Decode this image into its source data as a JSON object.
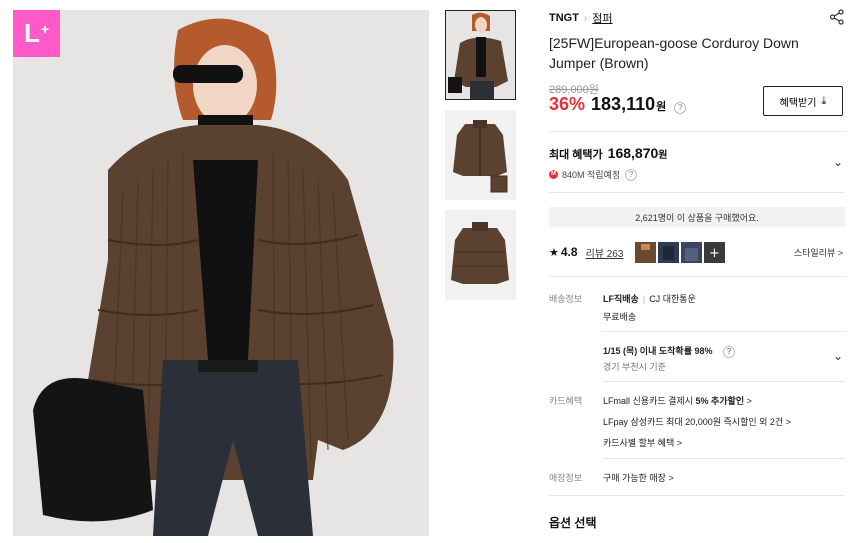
{
  "badge": {
    "text": "L",
    "plus": "+"
  },
  "product": {
    "brand": "TNGT",
    "category": "점퍼",
    "title": "[25FW]European-goose Corduroy Down Jumper (Brown)",
    "original_price": "289,000원",
    "discount": "36%",
    "price": "183,110",
    "currency": "원",
    "benefit_button": "혜택받기"
  },
  "max_benefit": {
    "label": "최대 혜택가",
    "price": "168,870",
    "currency": "원",
    "points": "840M 적립예정"
  },
  "purchase_notice": "2,621명이 이 상품을 구매했어요.",
  "reviews": {
    "rating": "4.8",
    "label": "리뷰 263",
    "style_link": "스타일리뷰 >"
  },
  "shipping": {
    "label": "배송정보",
    "method": "LF직배송",
    "carrier": "CJ 대한통운",
    "fee": "무료배송",
    "arrival": "1/15 (목) 이내 도착확률 98%",
    "origin": "경기 부천시 기준"
  },
  "card": {
    "label": "카드혜택",
    "line1_prefix": "LFmall 신용카드 결제시 ",
    "line1_bold": "5% 추가할인",
    "line1_suffix": " >",
    "line2": "LFpay 삼성카드 최대 20,000원 즉시할인 외 2건 >",
    "line3": "카드사별 할부 혜택 >"
  },
  "store": {
    "label": "매장정보",
    "link": "구매 가능한 매장 >"
  },
  "options_title": "옵션 선택",
  "colors": {
    "accent": "#e8303a",
    "badge": "#ff5ac8",
    "jacket": "#5a4130"
  }
}
